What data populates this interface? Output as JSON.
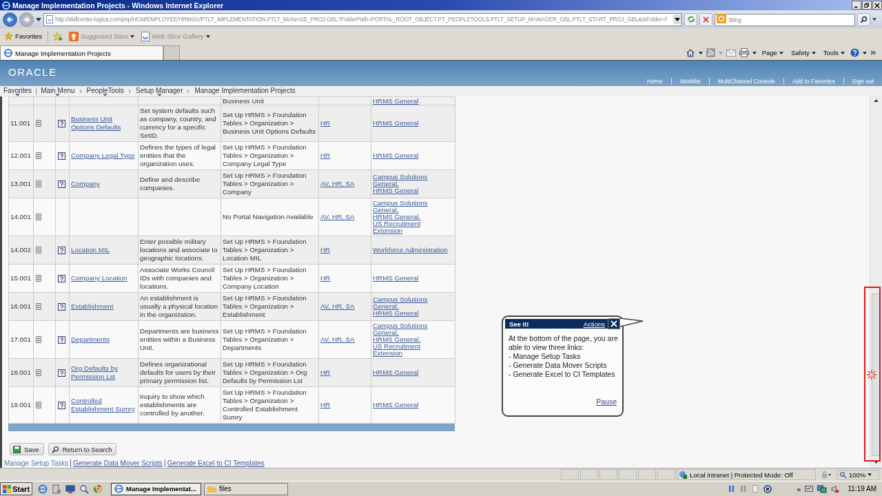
{
  "window": {
    "title": "Manage Implementation Projects - Windows Internet Explorer"
  },
  "address_bar": {
    "url": "http://skillcenter.logica.com/psp/HCM/EMPLOYEE/HRMS/c/PTLT_IMPLEMENTATION.PTLT_MANAGE_PROJ.GBL?FolderPath=PORTAL_ROOT_OBJECT.PT_PEOPLETOOLS.PTLT_SETUP_MANAGER_GBL.PTLT_START_PROJ_GBL&IsFolder=f",
    "search_placeholder": "Bing"
  },
  "favorites_bar": {
    "label": "Favorites",
    "items": [
      "Suggested Sites",
      "Web Slice Gallery"
    ]
  },
  "tabs": [
    {
      "label": "Manage Implementation Projects",
      "selected": true
    }
  ],
  "command_bar": [
    "Page",
    "Safety",
    "Tools"
  ],
  "header": {
    "logo": "ORACLE",
    "links": [
      "Home",
      "Worklist",
      "MultiChannel Console",
      "Add to Favorites",
      "Sign out"
    ]
  },
  "breadcrumb": [
    {
      "label": "Favorites",
      "has_menu": true
    },
    {
      "label": "Main Menu",
      "has_menu": true
    },
    {
      "label": "PeopleTools",
      "has_menu": true
    },
    {
      "label": "Setup Manager",
      "has_menu": true
    },
    {
      "label": "Manage Implementation Projects",
      "has_menu": false
    }
  ],
  "table": {
    "partial_row": {
      "navigation": "Business Unit",
      "features": [
        "HRMS General"
      ]
    },
    "rows": [
      {
        "seq": "11.001",
        "kind": "task",
        "name": "Business Unit Options Defaults",
        "description": "Set system defaults such as company, country, and currency for a specific SetID.",
        "navigation": "Set Up HRMS > Foundation Tables > Organization > Business Unit Options Defaults",
        "products": "HR",
        "features": [
          "HRMS General"
        ]
      },
      {
        "seq": "12.001",
        "kind": "task",
        "name": "Company Legal Type",
        "description": "Defines the types of legal entities that the organization uses.",
        "navigation": "Set Up HRMS > Foundation Tables > Organization > Company Legal Type",
        "products": "HR",
        "features": [
          "HRMS General"
        ]
      },
      {
        "seq": "13.001",
        "kind": "task",
        "name": "Company",
        "description": "Define and describe companies.",
        "navigation": "Set Up HRMS > Foundation Tables > Organization > Company",
        "products": "AV, HR, SA",
        "features": [
          "Campus Solutions General,",
          "HRMS General"
        ]
      },
      {
        "seq": "14.001",
        "kind": "plain",
        "navigation": "No Portal Navigation Available",
        "products": "AV, HR, SA",
        "features": [
          "Campus Solutions General,",
          "HRMS General,",
          "US Recruitment Extension"
        ]
      },
      {
        "seq": "14.002",
        "kind": "task",
        "name": "Location MIL",
        "description": "Enter possible military locations and associate to geographic locations.",
        "navigation": "Set Up HRMS > Foundation Tables > Organization > Location MIL",
        "products": "HR",
        "features": [
          "Workforce Administration"
        ]
      },
      {
        "seq": "15.001",
        "kind": "task",
        "name": "Company Location",
        "description": "Associate Works Council IDs with companies and locations.",
        "navigation": "Set Up HRMS > Foundation Tables > Organization > Company Location",
        "products": "HR",
        "features": [
          "HRMS General"
        ]
      },
      {
        "seq": "16.001",
        "kind": "task",
        "name": "Establishment",
        "description": "An establishment is usually a physical location in the organization.",
        "navigation": "Set Up HRMS > Foundation Tables > Organization > Establishment",
        "products": "AV, HR, SA",
        "features": [
          "Campus Solutions General,",
          "HRMS General"
        ]
      },
      {
        "seq": "17.001",
        "kind": "task",
        "name": "Departments",
        "description": "Departments are business entities within a Business Unit.",
        "navigation": "Set Up HRMS > Foundation Tables > Organization > Departments",
        "products": "AV, HR, SA",
        "features": [
          "Campus Solutions General,",
          "HRMS General,",
          "US Recruitment Extension"
        ]
      },
      {
        "seq": "18.001",
        "kind": "task",
        "name": "Org Defaults by Permission Lst",
        "description": "Defines organizational defaults for users by their primary permission list.",
        "navigation": "Set Up HRMS > Foundation Tables > Organization > Org Defaults by Permission Lst",
        "products": "HR",
        "features": [
          "HRMS General"
        ]
      },
      {
        "seq": "19.001",
        "kind": "task",
        "name": "Controlled Establishment Sumry",
        "description": "Inquiry to show which establishments are controlled by another.",
        "navigation": "Set Up HRMS > Foundation Tables > Organization > Controlled Establishment Sumry",
        "products": "HR",
        "features": [
          "HRMS General"
        ]
      }
    ]
  },
  "buttons": [
    {
      "label": "Save",
      "kind": "save"
    },
    {
      "label": "Return to Search",
      "kind": "search"
    }
  ],
  "page_links": [
    {
      "label": "Manage Setup Tasks",
      "selected": true
    },
    {
      "label": "Generate Data Mover Scripts",
      "selected": false
    },
    {
      "label": "Generate Excel to CI Templates",
      "selected": false
    }
  ],
  "callout": {
    "title": "See It!",
    "actions": "Actions",
    "text": "At the bottom of the page, you are able to view three links:",
    "items": [
      "- Manage Setup Tasks",
      "- Generate Data Mover Scripts",
      "- Generate Excel to CI Templates"
    ],
    "pause": "Pause"
  },
  "status_bar": {
    "zone": "Local intranet | Protected Mode: Off",
    "zoom": "100%"
  },
  "taskbar": {
    "start": "Start",
    "tasks": [
      {
        "label": "Manage Implementat...",
        "selected": true
      },
      {
        "label": "files",
        "selected": false
      }
    ],
    "tray_toggle": "«",
    "clock": "11:19 AM"
  }
}
